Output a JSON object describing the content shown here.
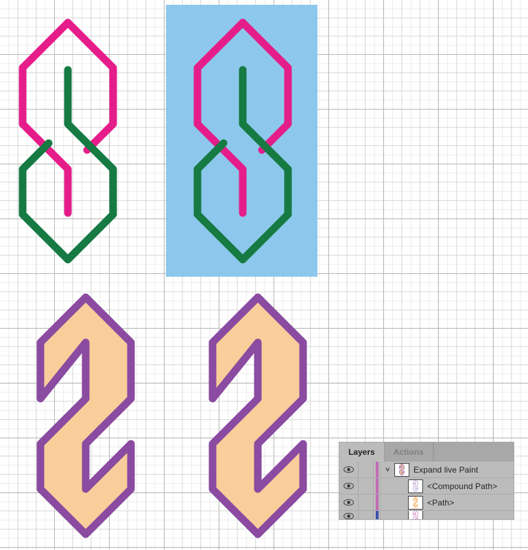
{
  "app": {
    "canvas_background": "#ffffff",
    "grid_fine_color": "#ececec",
    "grid_medium_color": "#d8d8d8",
    "grid_major_color": "#b9b9b9"
  },
  "palette": {
    "magenta": "#E51D8A",
    "green": "#167A43",
    "purple": "#8A4BA0",
    "orange": "#F9CE9A",
    "blue_fill": "#8DC8EC",
    "white": "#ffffff"
  },
  "artwork": {
    "objects": [
      {
        "id": "shape-top-left",
        "type": "live-paint-outline",
        "label": "Top-left outline S shape",
        "stroke_colors": [
          "#E51D8A",
          "#167A43"
        ],
        "fill": "none",
        "background": "none"
      },
      {
        "id": "shape-top-right",
        "type": "live-paint-outline-on-blue",
        "label": "Top-right outline S shape on blue rectangle",
        "stroke_colors": [
          "#E51D8A",
          "#167A43"
        ],
        "fill": "none",
        "background": "#8DC8EC"
      },
      {
        "id": "shape-bottom-left",
        "type": "expanded-compound-path",
        "label": "Bottom-left filled S shape",
        "stroke_colors": [
          "#8A4BA0"
        ],
        "fill": "#F9CE9A",
        "background": "none"
      },
      {
        "id": "shape-bottom-right",
        "type": "expanded-compound-path",
        "label": "Bottom-right filled S shape",
        "stroke_colors": [
          "#8A4BA0"
        ],
        "fill": "#F9CE9A",
        "background": "none"
      }
    ]
  },
  "layers_panel": {
    "tabs": [
      {
        "label": "Layers",
        "active": true
      },
      {
        "label": "Actions",
        "active": false
      }
    ],
    "selection_color": "#C16BB5",
    "sub_selection_color": "#3B4FB0",
    "rows": [
      {
        "name": "Expand live Paint",
        "indent": "root",
        "has_twirl": true,
        "twirl_glyph": "∨",
        "expanded": true,
        "visible": true,
        "eye_glyph": "eye",
        "color_chip": "#C16BB5",
        "thumb": "compound-orange-purple"
      },
      {
        "name": "<Compound Path>",
        "indent": "child",
        "has_twirl": false,
        "twirl_glyph": "",
        "expanded": false,
        "visible": true,
        "eye_glyph": "eye",
        "color_chip": "#C16BB5",
        "thumb": "outline-purple"
      },
      {
        "name": "<Path>",
        "indent": "child",
        "has_twirl": false,
        "twirl_glyph": "",
        "expanded": false,
        "visible": true,
        "eye_glyph": "eye",
        "color_chip": "#C16BB5",
        "thumb": "solid-orange"
      },
      {
        "name": "",
        "indent": "child",
        "has_twirl": false,
        "twirl_glyph": "",
        "expanded": false,
        "visible": true,
        "eye_glyph": "eye",
        "color_chip": "#3B4FB0",
        "thumb": "outline-magenta",
        "partial": true
      }
    ]
  }
}
